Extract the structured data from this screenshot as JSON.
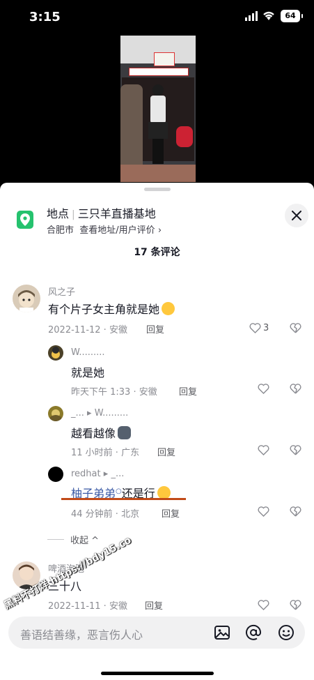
{
  "status": {
    "time": "3:15",
    "battery": "64"
  },
  "location": {
    "label": "地点",
    "name": "三只羊直播基地",
    "city": "合肥市",
    "action": "查看地址/用户评价",
    "chevron": "›"
  },
  "comments_count": "17 条评论",
  "comments": [
    {
      "user": "风之子",
      "text": "有个片子女主角就是她",
      "emoji": "laughing-crying-emoji",
      "date": "2022-11-12 · 安徽",
      "reply": "回复",
      "likes": "3"
    },
    {
      "user": "W.........",
      "text": "就是她",
      "date": "昨天下午 1:33 · 安徽",
      "reply": "回复"
    },
    {
      "user": "_...",
      "reply_to": "W.........",
      "text": "越看越像",
      "emoji": "cat-emoji",
      "date": "11 小时前 · 广东",
      "reply": "回复"
    },
    {
      "user": "redhat",
      "reply_to": "_...",
      "link_text": "柚子弟弟",
      "text": "还是行",
      "emoji": "grin-sunglasses-emoji",
      "date": "44 分钟前 · 北京",
      "reply": "回复"
    },
    {
      "user": "啤酒泡泡",
      "text": "三十八",
      "date": "2022-11-11 · 安徽",
      "reply": "回复"
    }
  ],
  "collapse_label": "收起",
  "input": {
    "placeholder": "善语结善缘，恶言伤人心"
  },
  "watermark": "黑料不打烊 https://bdy15.co",
  "colors": {
    "accent_green": "#25c26e",
    "link_blue": "#3b5aa5",
    "underline_red": "#c24a18"
  }
}
